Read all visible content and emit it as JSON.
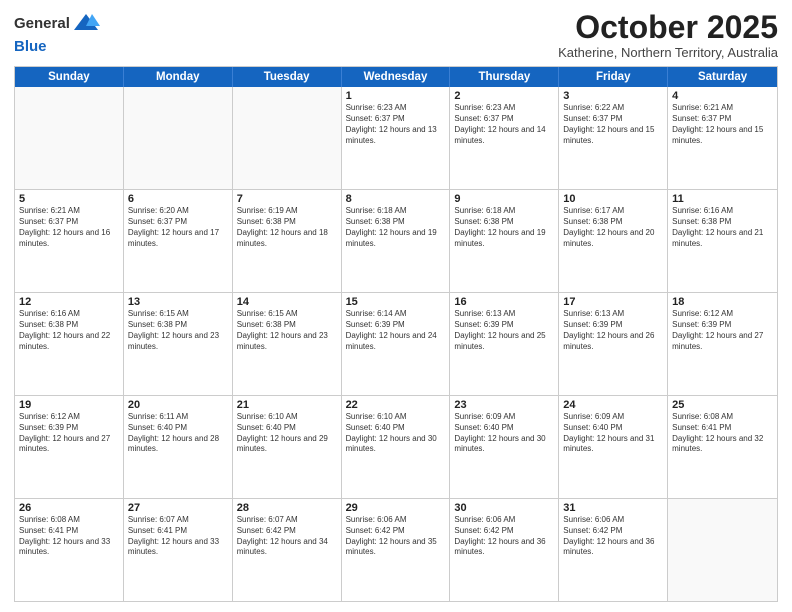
{
  "header": {
    "logo_general": "General",
    "logo_blue": "Blue",
    "month_title": "October 2025",
    "subtitle": "Katherine, Northern Territory, Australia"
  },
  "calendar": {
    "days_of_week": [
      "Sunday",
      "Monday",
      "Tuesday",
      "Wednesday",
      "Thursday",
      "Friday",
      "Saturday"
    ],
    "rows": [
      [
        {
          "day": "",
          "empty": true
        },
        {
          "day": "",
          "empty": true
        },
        {
          "day": "",
          "empty": true
        },
        {
          "day": "1",
          "sunrise": "6:23 AM",
          "sunset": "6:37 PM",
          "daylight": "12 hours and 13 minutes."
        },
        {
          "day": "2",
          "sunrise": "6:23 AM",
          "sunset": "6:37 PM",
          "daylight": "12 hours and 14 minutes."
        },
        {
          "day": "3",
          "sunrise": "6:22 AM",
          "sunset": "6:37 PM",
          "daylight": "12 hours and 15 minutes."
        },
        {
          "day": "4",
          "sunrise": "6:21 AM",
          "sunset": "6:37 PM",
          "daylight": "12 hours and 15 minutes."
        }
      ],
      [
        {
          "day": "5",
          "sunrise": "6:21 AM",
          "sunset": "6:37 PM",
          "daylight": "12 hours and 16 minutes."
        },
        {
          "day": "6",
          "sunrise": "6:20 AM",
          "sunset": "6:37 PM",
          "daylight": "12 hours and 17 minutes."
        },
        {
          "day": "7",
          "sunrise": "6:19 AM",
          "sunset": "6:38 PM",
          "daylight": "12 hours and 18 minutes."
        },
        {
          "day": "8",
          "sunrise": "6:18 AM",
          "sunset": "6:38 PM",
          "daylight": "12 hours and 19 minutes."
        },
        {
          "day": "9",
          "sunrise": "6:18 AM",
          "sunset": "6:38 PM",
          "daylight": "12 hours and 19 minutes."
        },
        {
          "day": "10",
          "sunrise": "6:17 AM",
          "sunset": "6:38 PM",
          "daylight": "12 hours and 20 minutes."
        },
        {
          "day": "11",
          "sunrise": "6:16 AM",
          "sunset": "6:38 PM",
          "daylight": "12 hours and 21 minutes."
        }
      ],
      [
        {
          "day": "12",
          "sunrise": "6:16 AM",
          "sunset": "6:38 PM",
          "daylight": "12 hours and 22 minutes."
        },
        {
          "day": "13",
          "sunrise": "6:15 AM",
          "sunset": "6:38 PM",
          "daylight": "12 hours and 23 minutes."
        },
        {
          "day": "14",
          "sunrise": "6:15 AM",
          "sunset": "6:38 PM",
          "daylight": "12 hours and 23 minutes."
        },
        {
          "day": "15",
          "sunrise": "6:14 AM",
          "sunset": "6:39 PM",
          "daylight": "12 hours and 24 minutes."
        },
        {
          "day": "16",
          "sunrise": "6:13 AM",
          "sunset": "6:39 PM",
          "daylight": "12 hours and 25 minutes."
        },
        {
          "day": "17",
          "sunrise": "6:13 AM",
          "sunset": "6:39 PM",
          "daylight": "12 hours and 26 minutes."
        },
        {
          "day": "18",
          "sunrise": "6:12 AM",
          "sunset": "6:39 PM",
          "daylight": "12 hours and 27 minutes."
        }
      ],
      [
        {
          "day": "19",
          "sunrise": "6:12 AM",
          "sunset": "6:39 PM",
          "daylight": "12 hours and 27 minutes."
        },
        {
          "day": "20",
          "sunrise": "6:11 AM",
          "sunset": "6:40 PM",
          "daylight": "12 hours and 28 minutes."
        },
        {
          "day": "21",
          "sunrise": "6:10 AM",
          "sunset": "6:40 PM",
          "daylight": "12 hours and 29 minutes."
        },
        {
          "day": "22",
          "sunrise": "6:10 AM",
          "sunset": "6:40 PM",
          "daylight": "12 hours and 30 minutes."
        },
        {
          "day": "23",
          "sunrise": "6:09 AM",
          "sunset": "6:40 PM",
          "daylight": "12 hours and 30 minutes."
        },
        {
          "day": "24",
          "sunrise": "6:09 AM",
          "sunset": "6:40 PM",
          "daylight": "12 hours and 31 minutes."
        },
        {
          "day": "25",
          "sunrise": "6:08 AM",
          "sunset": "6:41 PM",
          "daylight": "12 hours and 32 minutes."
        }
      ],
      [
        {
          "day": "26",
          "sunrise": "6:08 AM",
          "sunset": "6:41 PM",
          "daylight": "12 hours and 33 minutes."
        },
        {
          "day": "27",
          "sunrise": "6:07 AM",
          "sunset": "6:41 PM",
          "daylight": "12 hours and 33 minutes."
        },
        {
          "day": "28",
          "sunrise": "6:07 AM",
          "sunset": "6:42 PM",
          "daylight": "12 hours and 34 minutes."
        },
        {
          "day": "29",
          "sunrise": "6:06 AM",
          "sunset": "6:42 PM",
          "daylight": "12 hours and 35 minutes."
        },
        {
          "day": "30",
          "sunrise": "6:06 AM",
          "sunset": "6:42 PM",
          "daylight": "12 hours and 36 minutes."
        },
        {
          "day": "31",
          "sunrise": "6:06 AM",
          "sunset": "6:42 PM",
          "daylight": "12 hours and 36 minutes."
        },
        {
          "day": "",
          "empty": true
        }
      ]
    ]
  }
}
